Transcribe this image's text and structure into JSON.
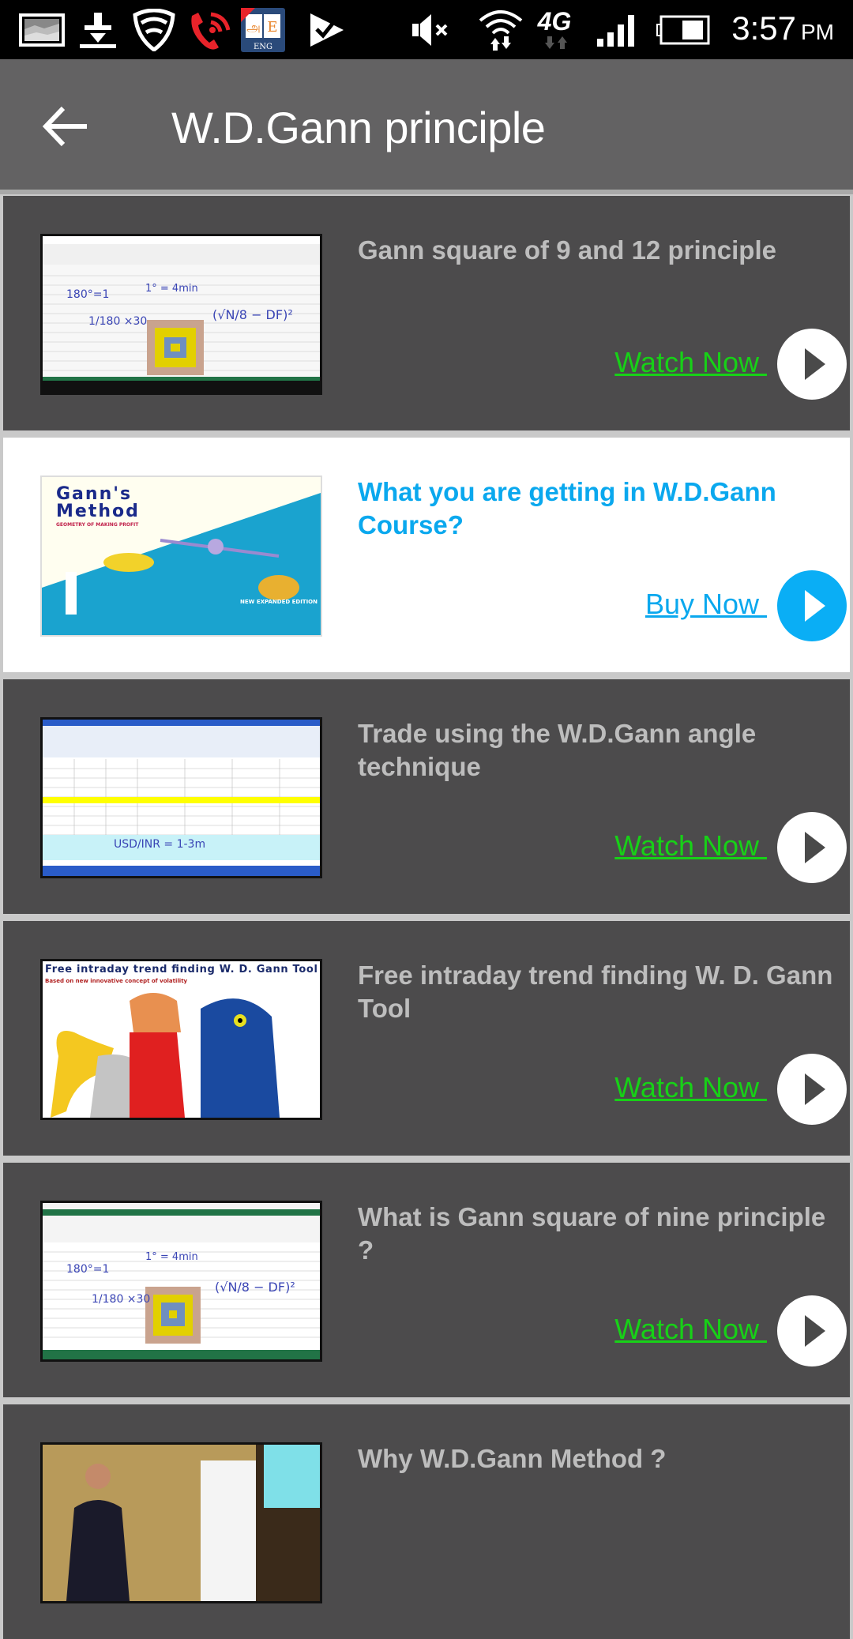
{
  "status_bar": {
    "time": "3:57",
    "ampm": "PM",
    "network": "4G",
    "left_icons": [
      "gallery-icon",
      "download-icon",
      "shield-wifi-icon",
      "wifi-call-icon",
      "tamil-english-dictionary-icon",
      "play-store-check-icon"
    ],
    "right_icons": [
      "mute-icon",
      "wifi-icon",
      "4g-icon",
      "signal-icon",
      "battery-icon"
    ]
  },
  "app_bar": {
    "title": "W.D.Gann principle",
    "back_icon": "arrow-left-icon"
  },
  "colors": {
    "app_bar": "#636263",
    "card_dark": "#4c4b4c",
    "card_light": "#ffffff",
    "watch_green": "#17d117",
    "accent_blue": "#0aa8ee",
    "title_gray": "#bdbdbd"
  },
  "items": [
    {
      "title": "Gann square of 9 and 12 principle",
      "action": "Watch Now ",
      "style": "dark",
      "thumbnail": "excel-gann-square-whiteboard"
    },
    {
      "title": "What you are getting in W.D.Gann Course?",
      "action": "Buy Now ",
      "style": "light",
      "thumbnail": "gann-method-book-cover",
      "thumb_text": {
        "line1": "Gann's",
        "line2": "Method",
        "subtitle": "GEOMETRY OF MAKING PROFIT",
        "edition": "NEW EXPANDED EDITION"
      }
    },
    {
      "title": "Trade using the W.D.Gann angle technique",
      "action": "Watch Now ",
      "style": "dark",
      "thumbnail": "excel-gann-angle-table",
      "thumb_text": {
        "note": "USD/INR = 1-3m"
      }
    },
    {
      "title": "Free intraday trend finding W. D. Gann Tool",
      "action": "Watch Now ",
      "style": "dark",
      "thumbnail": "cartoon-characters",
      "thumb_text": {
        "heading": "Free intraday trend finding W. D. Gann Tool",
        "sub": "Based on new innovative concept of volatility"
      }
    },
    {
      "title": "What is Gann square of nine principle ?",
      "action": "Watch Now ",
      "style": "dark",
      "thumbnail": "excel-gann-square-nine"
    },
    {
      "title": "Why W.D.Gann Method ?",
      "action": "",
      "style": "dark",
      "thumbnail": "presenter-photo"
    }
  ]
}
